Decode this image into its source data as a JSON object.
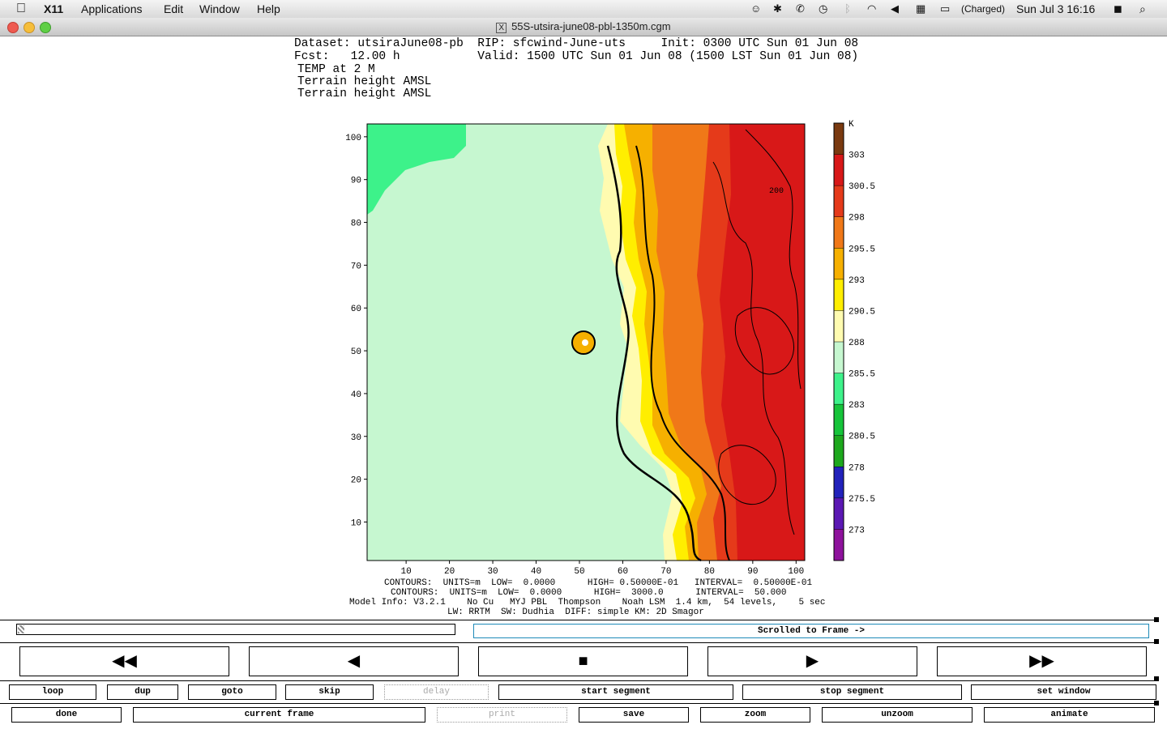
{
  "menubar": {
    "app": "X11",
    "items": [
      "Applications",
      "Edit",
      "Window",
      "Help"
    ],
    "battery": "(Charged)",
    "clock": "Sun Jul 3  16:16"
  },
  "window": {
    "title": "55S-utsira-june08-pbl-1350m.cgm"
  },
  "header": {
    "dataset": "Dataset: utsiraJune08-pb  RIP: sfcwind-June-uts     Init: 0300 UTC Sun 01 Jun 08",
    "fcst": "Fcst:   12.00 h           Valid: 1500 UTC Sun 01 Jun 08 (1500 LST Sun 01 Jun 08)",
    "field": "TEMP at 2 M",
    "terrain1": "Terrain height AMSL",
    "terrain2": "Terrain height AMSL"
  },
  "chart_data": {
    "type": "heatmap",
    "x_ticks": [
      "10",
      "20",
      "30",
      "40",
      "50",
      "60",
      "70",
      "80",
      "90",
      "100"
    ],
    "y_ticks": [
      "100",
      "90",
      "80",
      "70",
      "60",
      "50",
      "40",
      "30",
      "20",
      "10"
    ],
    "xlim": [
      1,
      102
    ],
    "ylim": [
      1,
      103
    ],
    "contour_label": "200",
    "colorbar": {
      "unit": "K",
      "levels": [
        "303",
        "300.5",
        "298",
        "295.5",
        "293",
        "290.5",
        "288",
        "285.5",
        "283",
        "280.5",
        "278",
        "275.5",
        "273"
      ],
      "colors": [
        "#7a3a10",
        "#d81818",
        "#e53a1a",
        "#f07818",
        "#f6b000",
        "#ffee00",
        "#fffbb0",
        "#c6f7d0",
        "#3df28a",
        "#16c43a",
        "#1da81d",
        "#2222bb",
        "#5b18b3",
        "#8e129c"
      ]
    }
  },
  "contour_info": {
    "line1": "CONTOURS:  UNITS=m  LOW=  0.0000      HIGH= 0.50000E-01   INTERVAL=  0.50000E-01",
    "line2": "CONTOURS:  UNITS=m  LOW=  0.0000      HIGH=  3000.0      INTERVAL=  50.000",
    "line3": "Model Info: V3.2.1    No Cu   MYJ PBL  Thompson    Noah LSM  1.4 km,  54 levels,    5 sec",
    "line4": "LW: RRTM  SW: Dudhia  DIFF: simple KM: 2D Smagor"
  },
  "controls": {
    "status": "Scrolled to Frame ->",
    "transport": [
      {
        "name": "rewind",
        "glyph": "◀◀"
      },
      {
        "name": "step-back",
        "glyph": "◀"
      },
      {
        "name": "stop",
        "glyph": "■"
      },
      {
        "name": "play",
        "glyph": "▶"
      },
      {
        "name": "fast-forward",
        "glyph": "▶▶"
      }
    ],
    "row1": [
      "loop",
      "dup",
      "goto",
      "skip",
      "delay",
      "start segment",
      "stop segment",
      "set window"
    ],
    "row2": [
      "done",
      "current frame",
      "print",
      "save",
      "zoom",
      "unzoom",
      "animate"
    ]
  }
}
